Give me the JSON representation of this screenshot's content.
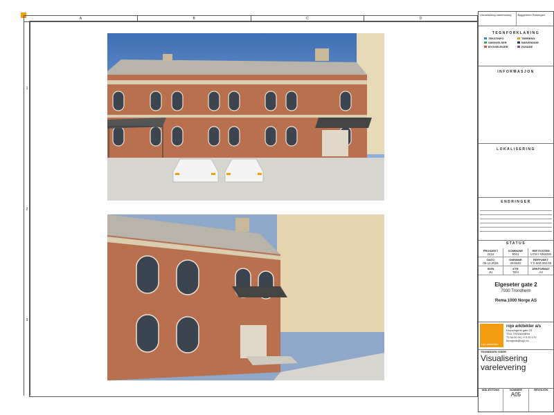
{
  "grid": {
    "columns": [
      "A",
      "B",
      "C",
      "D"
    ],
    "rows": [
      "1",
      "2",
      "3"
    ]
  },
  "title_block": {
    "top_labels": [
      "Visualisering varelevering",
      "Byggeieren Rosengen"
    ],
    "legend_title": "TEGNFORKLARING",
    "legend": [
      {
        "label": "TEKSTINFO",
        "color": "#1e88e5"
      },
      {
        "label": "TERRENG",
        "color": "#f39c12"
      },
      {
        "label": "OMGIVELSER",
        "color": "#27ae60"
      },
      {
        "label": "INNVENDIGE",
        "color": "#2c3e50"
      },
      {
        "label": "BYGGELINJER",
        "color": "#e74c3c"
      },
      {
        "label": "FASADE",
        "color": "#8e44ad"
      }
    ],
    "information_title": "INFORMASJON",
    "lokalisering_title": "LOKALISERING",
    "endringer_title": "ENDRINGER",
    "status_title": "STATUS",
    "project_cells": [
      {
        "label": "PROSJEKT",
        "value": "2415"
      },
      {
        "label": "KOMMUNE",
        "value": "5001"
      },
      {
        "label": "REF.SYSTEM",
        "value": "UTM / NN2000"
      },
      {
        "label": "DATO",
        "value": "05.11.2025"
      },
      {
        "label": "GNR/BNR",
        "value": "404/602"
      },
      {
        "label": "REFPUNKT",
        "value": "Y 0.000.000,00"
      },
      {
        "label": "SIGN",
        "value": "JU"
      },
      {
        "label": "KTR",
        "value": "TEH"
      },
      {
        "label": "ARKFORMAT",
        "value": "A3"
      }
    ],
    "address_line1": "Elgeseter gate 2",
    "address_line2": "7030 Trondheim",
    "client": "Rema 1000 Norge AS",
    "firm_logo_text": "rojo arkitekter",
    "firm_name": "rojo arkitekter a/s",
    "firm_address": [
      "Dronningens gate 15",
      "7011 TRONDHEIM",
      "73 54 00 00 | 9 9 20 170",
      "firmapost@rojo.no"
    ],
    "drawing_label": "TEGNINGEN VISER",
    "drawing_title": "Visualisering varelevering",
    "footer_labels": [
      "MÅLESTOKK",
      "NUMMER",
      "REVISJON"
    ],
    "drawing_number": "A05"
  }
}
